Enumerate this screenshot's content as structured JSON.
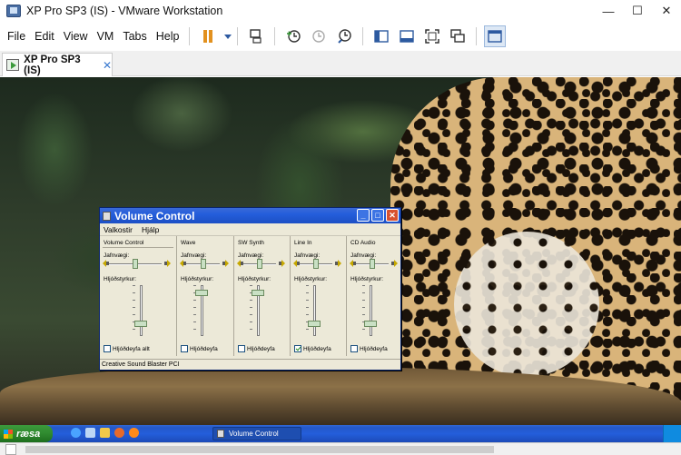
{
  "window": {
    "title": "XP Pro SP3 (IS) - VMware Workstation",
    "controls": {
      "minimize": "—",
      "maximize": "☐",
      "close": "✕"
    }
  },
  "menubar": {
    "items": [
      "File",
      "Edit",
      "View",
      "VM",
      "Tabs",
      "Help"
    ],
    "toolbar_icons": [
      "pause-icon",
      "send-ctrl-alt-del-icon",
      "snapshot-icon",
      "revert-snapshot-icon",
      "snapshot-manager-icon",
      "library-icon",
      "thumbnail-bar-icon",
      "full-screen-icon",
      "unity-icon",
      "console-view-icon"
    ]
  },
  "tabs": {
    "active_label": "XP Pro SP3 (IS)",
    "close_glyph": "✕"
  },
  "guest": {
    "volume_window": {
      "title": "Volume Control",
      "title_buttons": {
        "minimize": "_",
        "maximize": "□",
        "close": "✕"
      },
      "menu": [
        "Valkostir",
        "Hjálp"
      ],
      "columns": [
        {
          "name": "Volume Control",
          "balance_label": "Jafnvægi:",
          "volume_label": "Hljóðstyrkur:",
          "mute_label": "Hljóðdeyfa allt",
          "muted": false,
          "balance": 0.5,
          "volume": 0.25
        },
        {
          "name": "Wave",
          "balance_label": "Jafnvægi:",
          "volume_label": "Hljóðstyrkur:",
          "mute_label": "Hljóðdeyfa",
          "muted": false,
          "balance": 0.5,
          "volume": 0.85
        },
        {
          "name": "SW Synth",
          "balance_label": "Jafnvægi:",
          "volume_label": "Hljóðstyrkur:",
          "mute_label": "Hljóðdeyfa",
          "muted": false,
          "balance": 0.5,
          "volume": 0.85
        },
        {
          "name": "Line In",
          "balance_label": "Jafnvægi:",
          "volume_label": "Hljóðstyrkur:",
          "mute_label": "Hljóðdeyfa",
          "muted": true,
          "balance": 0.5,
          "volume": 0.25
        },
        {
          "name": "CD Audio",
          "balance_label": "Jafnvægi:",
          "volume_label": "Hljóðstyrkur:",
          "mute_label": "Hljóðdeyfa",
          "muted": false,
          "balance": 0.5,
          "volume": 0.25
        }
      ],
      "status_text": "Creative Sound Blaster PCI"
    },
    "taskbar": {
      "start_label": "ræsa",
      "quick_launch_icons": [
        "internet-explorer-icon",
        "show-desktop-icon",
        "windows-explorer-icon",
        "media-player-icon",
        "firefox-icon"
      ],
      "task_label": "Volume Control"
    }
  },
  "colors": {
    "xp_title_blue": "#245edb",
    "xp_taskbar": "#245edb",
    "start_green": "#2f8a2f",
    "dialog_face": "#ece9d8",
    "pause_orange": "#e2911f"
  }
}
